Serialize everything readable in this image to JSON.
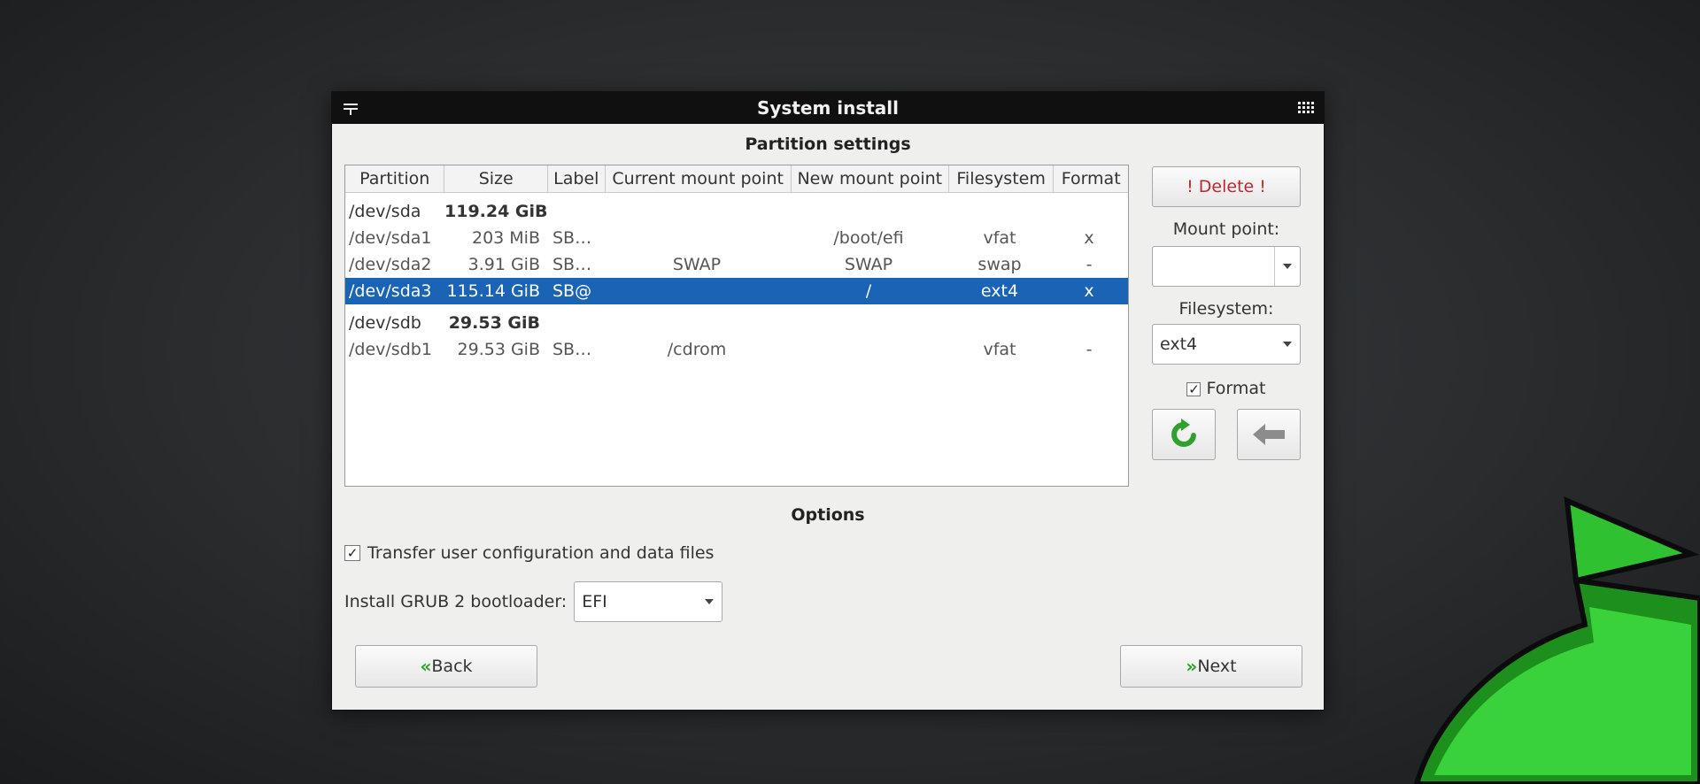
{
  "window": {
    "title": "System install"
  },
  "partition_settings": {
    "title": "Partition settings",
    "columns": [
      "Partition",
      "Size",
      "Label",
      "Current mount point",
      "New mount point",
      "Filesystem",
      "Format"
    ],
    "groups": [
      {
        "device": "/dev/sda",
        "size": "119.24 GiB",
        "partitions": [
          {
            "partition": "/dev/sda1",
            "size": "203 MiB",
            "label": "SB…",
            "current_mount": "",
            "new_mount": "/boot/efi",
            "filesystem": "vfat",
            "format": "x"
          },
          {
            "partition": "/dev/sda2",
            "size": "3.91 GiB",
            "label": "SB…",
            "current_mount": "SWAP",
            "new_mount": "SWAP",
            "filesystem": "swap",
            "format": "-"
          },
          {
            "partition": "/dev/sda3",
            "size": "115.14 GiB",
            "label": "SB@",
            "current_mount": "",
            "new_mount": "/",
            "filesystem": "ext4",
            "format": "x",
            "selected": true
          }
        ]
      },
      {
        "device": "/dev/sdb",
        "size": "29.53 GiB",
        "partitions": [
          {
            "partition": "/dev/sdb1",
            "size": "29.53 GiB",
            "label": "SB…",
            "current_mount": "/cdrom",
            "new_mount": "",
            "filesystem": "vfat",
            "format": "-"
          }
        ]
      }
    ]
  },
  "side_panel": {
    "delete_label": "! Delete !",
    "mount_point_label": "Mount point:",
    "mount_point_value": "",
    "filesystem_label": "Filesystem:",
    "filesystem_value": "ext4",
    "format_label": "Format",
    "format_checked": true
  },
  "options": {
    "title": "Options",
    "transfer_label": "Transfer user configuration and data files",
    "transfer_checked": true,
    "grub_label": "Install GRUB 2 bootloader:",
    "grub_value": "EFI"
  },
  "navigation": {
    "back_label": "Back",
    "next_label": "Next"
  },
  "colors": {
    "selection": "#1a63b5",
    "delete_text": "#c0272d",
    "accent_green": "#2fa12c",
    "titlebar": "#101010"
  }
}
